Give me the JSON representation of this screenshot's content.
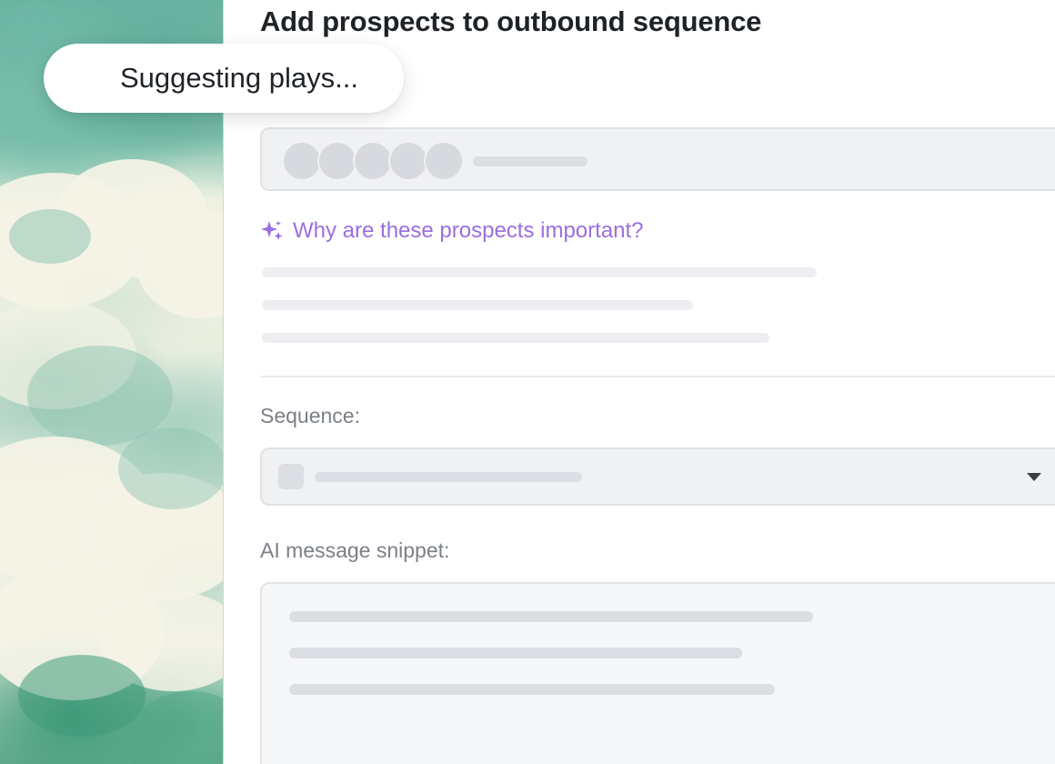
{
  "toast": {
    "text": "Suggesting plays..."
  },
  "header": {
    "title": "Add prospects to outbound sequence"
  },
  "prospects": {
    "avatar_count": 5,
    "why_link": "Why are these prospects important?",
    "why_icon": "sparkle-icon"
  },
  "sequence": {
    "label": "Sequence:",
    "dropdown_icon": "chevron-down-icon"
  },
  "snippet": {
    "label": "AI message snippet:"
  },
  "colors": {
    "accent": "#9b6ee0",
    "skeleton": "#dcdee3",
    "skeleton_light": "#eceef1",
    "field_background": "#f0f1f3",
    "title_text": "#1f2328",
    "label_text": "#7b7f87"
  }
}
